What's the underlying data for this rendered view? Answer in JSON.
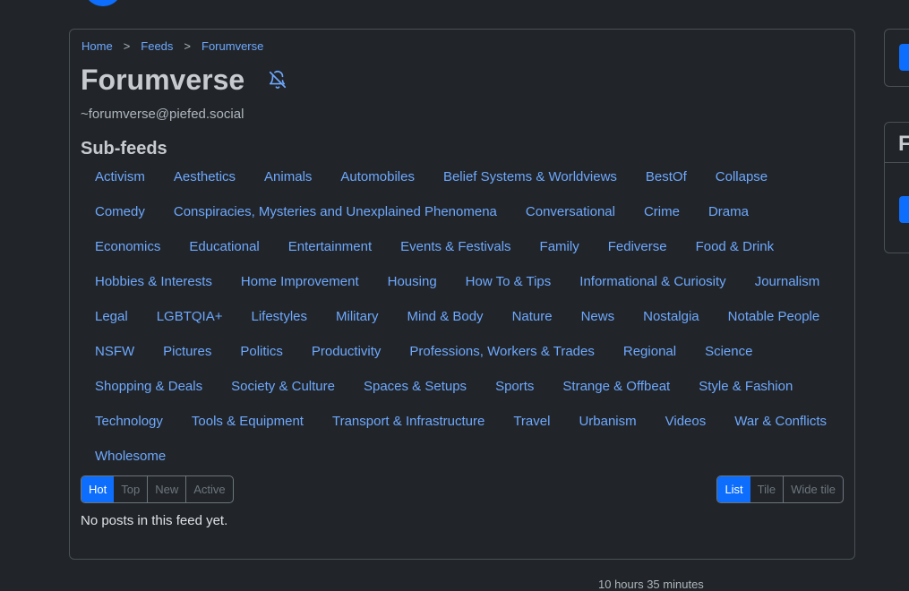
{
  "breadcrumb": {
    "items": [
      "Home",
      "Feeds",
      "Forumverse"
    ],
    "separator": ">"
  },
  "feed": {
    "title": "Forumverse",
    "handle": "~forumverse@piefed.social",
    "notification_icon": "bell-slash-icon"
  },
  "subfeeds": {
    "heading": "Sub-feeds",
    "items": [
      "Activism",
      "Aesthetics",
      "Animals",
      "Automobiles",
      "Belief Systems & Worldviews",
      "BestOf",
      "Collapse",
      "Comedy",
      "Conspiracies, Mysteries and Unexplained Phenomena",
      "Conversational",
      "Crime",
      "Drama",
      "Economics",
      "Educational",
      "Entertainment",
      "Events & Festivals",
      "Family",
      "Fediverse",
      "Food & Drink",
      "Hobbies & Interests",
      "Home Improvement",
      "Housing",
      "How To & Tips",
      "Informational & Curiosity",
      "Journalism",
      "Legal",
      "LGBTQIA+",
      "Lifestyles",
      "Military",
      "Mind & Body",
      "Nature",
      "News",
      "Nostalgia",
      "Notable People",
      "NSFW",
      "Pictures",
      "Politics",
      "Productivity",
      "Professions, Workers & Trades",
      "Regional",
      "Science",
      "Shopping & Deals",
      "Society & Culture",
      "Spaces & Setups",
      "Sports",
      "Strange & Offbeat",
      "Style & Fashion",
      "Technology",
      "Tools & Equipment",
      "Transport & Infrastructure",
      "Travel",
      "Urbanism",
      "Videos",
      "War & Conflicts",
      "Wholesome"
    ]
  },
  "sort": {
    "options": [
      "Hot",
      "Top",
      "New",
      "Active"
    ],
    "selected": "Hot"
  },
  "layout": {
    "options": [
      "List",
      "Tile",
      "Wide tile"
    ],
    "selected": "List"
  },
  "empty_message": "No posts in this feed yet.",
  "sidebar": {
    "second_card_heading_peek": "F"
  },
  "footer_peek": "10 hours 35 minutes",
  "colors": {
    "background": "#212529",
    "accent": "#0d6efd",
    "link": "#6ea8fe",
    "border": "#495057"
  }
}
